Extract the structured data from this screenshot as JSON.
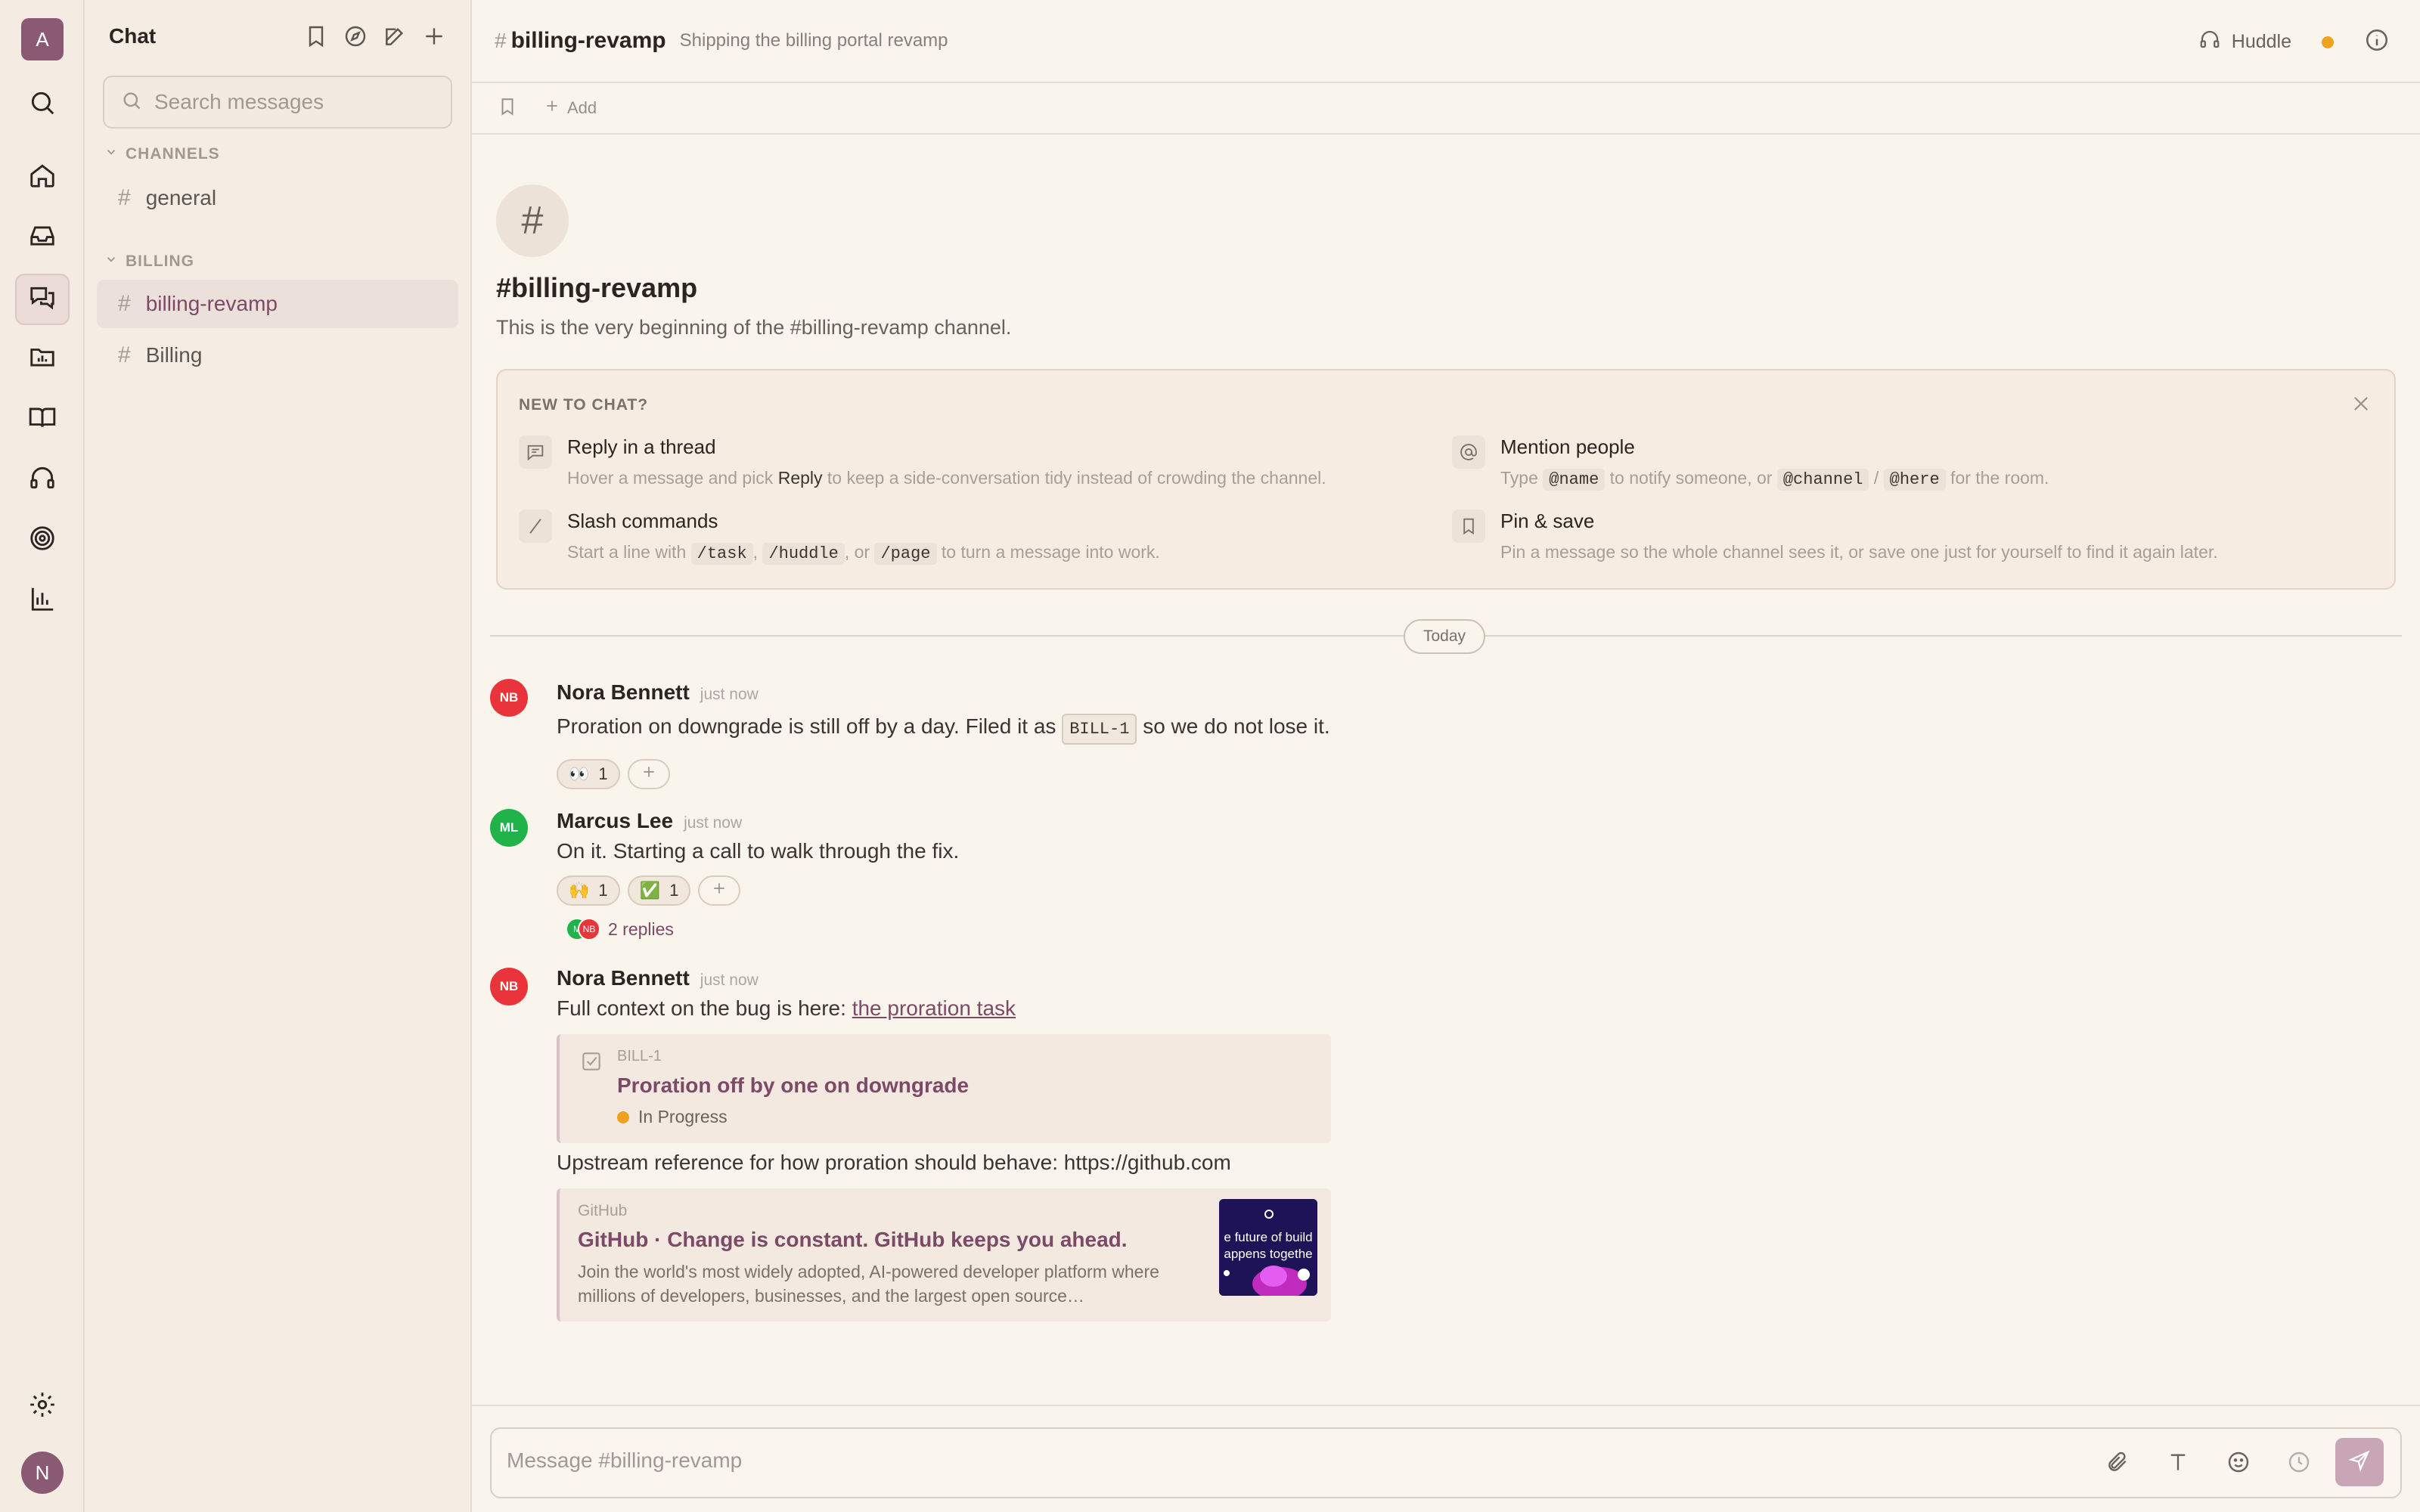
{
  "rail": {
    "workspace_initial": "A",
    "user_initial": "N",
    "items": [
      "search-icon",
      "home-icon",
      "inbox-icon",
      "chat-icon",
      "folder-chart-icon",
      "book-icon",
      "headphones-icon",
      "target-icon",
      "bar-chart-icon",
      "settings-icon"
    ],
    "active": "chat-icon"
  },
  "sidebar": {
    "title": "Chat",
    "search_placeholder": "Search messages",
    "sections": [
      {
        "label": "CHANNELS",
        "channels": [
          {
            "name": "general"
          }
        ]
      },
      {
        "label": "BILLING",
        "channels": [
          {
            "name": "billing-revamp",
            "active": true
          },
          {
            "name": "Billing"
          }
        ]
      }
    ]
  },
  "header": {
    "hash": "#",
    "channel": "billing-revamp",
    "topic": "Shipping the billing portal revamp",
    "huddle_label": "Huddle",
    "add_bookmark_label": "Add"
  },
  "intro": {
    "icon_glyph": "#",
    "title": "#billing-revamp",
    "subtitle": "This is the very beginning of the #billing-revamp channel."
  },
  "tips": {
    "heading": "NEW TO CHAT?",
    "items": [
      {
        "title": "Reply in a thread",
        "desc_before": "Hover a message and pick ",
        "desc_strong": "Reply",
        "desc_after": " to keep a side-conversation tidy instead of crowding the channel."
      },
      {
        "title": "Mention people",
        "desc_1": "Type ",
        "code_1": "@name",
        "desc_2": " to notify someone, or ",
        "code_2": "@channel",
        "desc_3": " / ",
        "code_3": "@here",
        "desc_4": " for the room."
      },
      {
        "title": "Slash commands",
        "desc_1": "Start a line with ",
        "code_1": "/task",
        "desc_2": ", ",
        "code_2": "/huddle",
        "desc_3": ", or ",
        "code_3": "/page",
        "desc_4": " to turn a message into work."
      },
      {
        "title": "Pin & save",
        "desc": "Pin a message so the whole channel sees it, or save one just for yourself to find it again later."
      }
    ]
  },
  "divider_label": "Today",
  "messages": [
    {
      "initials": "NB",
      "author": "Nora Bennett",
      "time": "just now",
      "avatar_color": "#e8343a",
      "text_before": "Proration on downgrade is still off by a day. Filed it as ",
      "chip": "BILL-1",
      "text_after": " so we do not lose it.",
      "reactions": [
        {
          "emoji": "👀",
          "count": "1"
        }
      ]
    },
    {
      "initials": "ML",
      "author": "Marcus Lee",
      "time": "just now",
      "avatar_color": "#1fb34a",
      "text": "On it. Starting a call to walk through the fix.",
      "reactions": [
        {
          "emoji": "🙌",
          "count": "1"
        },
        {
          "emoji": "✅",
          "count": "1"
        }
      ],
      "thread": {
        "avatars": [
          "M",
          "NB"
        ],
        "label": "2 replies"
      }
    },
    {
      "initials": "NB",
      "author": "Nora Bennett",
      "time": "just now",
      "avatar_color": "#e8343a",
      "text_before": "Full context on the bug is here: ",
      "link_text": "the proration task",
      "task": {
        "key": "BILL-1",
        "title": "Proration off by one on downgrade",
        "status": "In Progress"
      },
      "text_2": "Upstream reference for how proration should behave: https://github.com",
      "link_preview": {
        "site": "GitHub",
        "title": "GitHub · Change is constant. GitHub keeps you ahead.",
        "description": "Join the world's most widely adopted, AI-powered developer platform where millions of developers, businesses, and the largest open source…",
        "thumb_text_1": "e future of build",
        "thumb_text_2": "appens togethe"
      }
    }
  ],
  "composer": {
    "placeholder": "Message #billing-revamp"
  },
  "colors": {
    "accent": "#7c4a66",
    "status_in_progress": "#f0a21e",
    "background": "#f9f4ec"
  }
}
